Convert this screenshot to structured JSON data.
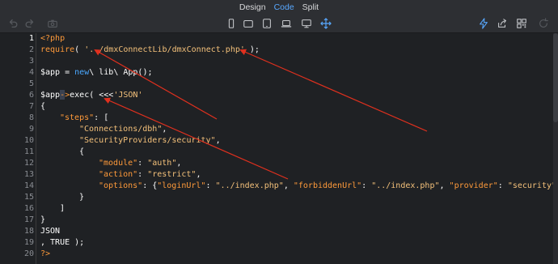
{
  "tabs": [
    "Design",
    "Code",
    "Split"
  ],
  "active_tab": "Code",
  "colors": {
    "accent": "#58a8ff",
    "annotation": "#e0301e",
    "keyword": "#ff9a3a",
    "string": "#f3c07a"
  },
  "toolbar": {
    "left_icons": [
      "undo-icon",
      "redo-icon",
      "screenshot-icon"
    ],
    "center_icons": [
      "phone-icon",
      "tablet-landscape-icon",
      "tablet-portrait-icon",
      "laptop-icon",
      "desktop-icon",
      "move-icon"
    ],
    "right_icons": [
      "lightning-icon",
      "share-icon",
      "qr-code-icon",
      "refresh-icon"
    ]
  },
  "line_numbers": [
    "1",
    "2",
    "3",
    "4",
    "5",
    "6",
    "7",
    "8",
    "9",
    "10",
    "11",
    "12",
    "13",
    "14",
    "15",
    "16",
    "17",
    "18",
    "19",
    "20"
  ],
  "active_line": "1",
  "code": {
    "l1": {
      "open": "<?php"
    },
    "l2": {
      "require": "require",
      "open": "( ",
      "path": "'../dmxConnectLib/dmxConnect.php'",
      "close": " );"
    },
    "l4": {
      "var": "$app = ",
      "new": "new",
      "rest": "\\ lib\\ App();"
    },
    "l6": {
      "var": "$app",
      "arrow": "->",
      "call": "exec( <<<",
      "tag": "'JSON'"
    },
    "l7": {
      "brace": "{"
    },
    "l8": {
      "key": "\"steps\"",
      "rest": ": ["
    },
    "l9": {
      "str": "\"Connections/dbh\"",
      "rest": ","
    },
    "l10": {
      "str": "\"SecurityProviders/security\"",
      "rest": ","
    },
    "l11": {
      "brace": "{"
    },
    "l12": {
      "key": "\"module\"",
      "sep": ": ",
      "val": "\"auth\"",
      "end": ","
    },
    "l13": {
      "key": "\"action\"",
      "sep": ": ",
      "val": "\"restrict\"",
      "end": ","
    },
    "l14": {
      "key": "\"options\"",
      "sep": ": {",
      "k1": "\"loginUrl\"",
      "s1": ": ",
      "v1": "\"../index.php\"",
      "c1": ", ",
      "k2": "\"forbiddenUrl\"",
      "s2": ": ",
      "v2": "\"../index.php\"",
      "c2": ", ",
      "k3": "\"provider\"",
      "s3": ": ",
      "v3": "\"security\"",
      "end": "}"
    },
    "l15": {
      "brace": "}"
    },
    "l16": {
      "bracket": "]"
    },
    "l17": {
      "brace": "}"
    },
    "l18": {
      "tag": "JSON"
    },
    "l19": {
      "end": ", TRUE );"
    },
    "l20": {
      "close": "?>"
    }
  }
}
